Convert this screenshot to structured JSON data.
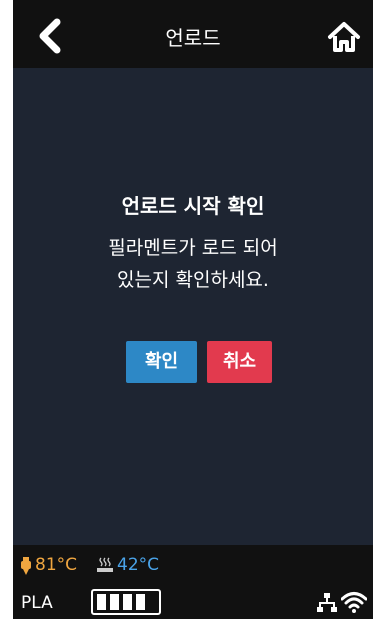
{
  "header": {
    "title": "언로드",
    "back_icon": "chevron-left-icon",
    "home_icon": "home-icon"
  },
  "dialog": {
    "title": "언로드 시작 확인",
    "message_line1": "필라멘트가 로드 되어",
    "message_line2": "있는지 확인하세요.",
    "confirm_label": "확인",
    "cancel_label": "취소"
  },
  "status": {
    "nozzle_temp": "81°C",
    "bed_temp": "42°C",
    "material": "PLA",
    "battery_level": 4,
    "battery_max": 4,
    "icons": [
      "nozzle-icon",
      "bed-heat-icon",
      "lan-icon",
      "wifi-icon"
    ]
  },
  "colors": {
    "background": "#1e2532",
    "bar": "#111111",
    "confirm": "#2d88c6",
    "cancel": "#e23a4e",
    "nozzle_temp": "#f0a640",
    "bed_temp": "#4aa3e8"
  }
}
